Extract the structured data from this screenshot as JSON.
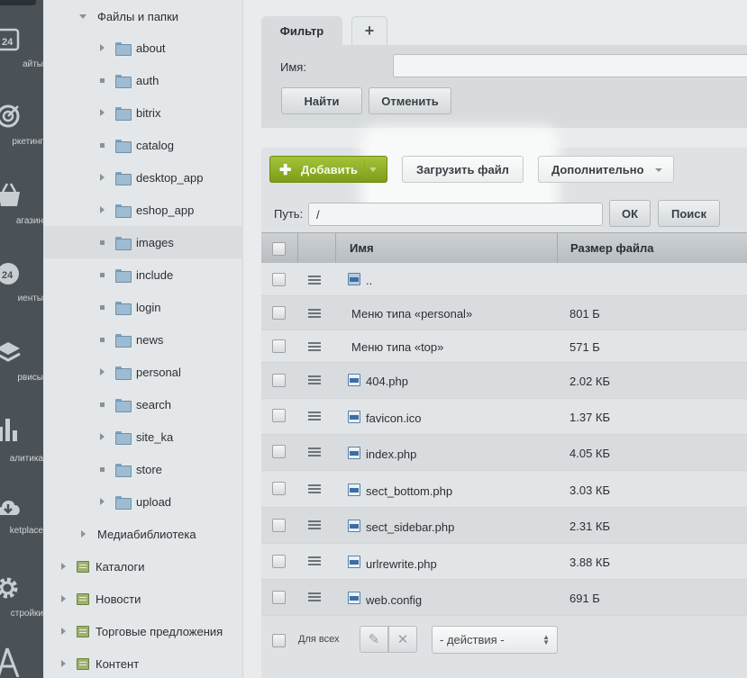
{
  "rail": {
    "items": [
      {
        "icon": "calendar-24-icon",
        "label": "айты"
      },
      {
        "icon": "target-icon",
        "label": "ркетинг"
      },
      {
        "icon": "basket-icon",
        "label": "агазин"
      },
      {
        "icon": "clients-24-icon",
        "label": "иенты"
      },
      {
        "icon": "layers-icon",
        "label": "рвисы"
      },
      {
        "icon": "bar-chart-icon",
        "label": "алитика"
      },
      {
        "icon": "cloud-download-icon",
        "label": "ketplace"
      },
      {
        "icon": "gear-icon",
        "label": "стройки"
      },
      {
        "icon": "logo-icon",
        "label": ""
      }
    ]
  },
  "tree": {
    "root": "Файлы и папки",
    "folders": [
      "about",
      "auth",
      "bitrix",
      "catalog",
      "desktop_app",
      "eshop_app",
      "images",
      "include",
      "login",
      "news",
      "personal",
      "search",
      "site_ka",
      "store",
      "upload"
    ],
    "media": "Медиабиблиотека",
    "sections": [
      "Каталоги",
      "Новости",
      "Торговые предложения",
      "Контент"
    ]
  },
  "filter": {
    "tab_label": "Фильтр",
    "add_tab": "+",
    "name_label": "Имя:",
    "name_value": "",
    "find_button": "Найти",
    "cancel_button": "Отменить"
  },
  "toolbar": {
    "add_button": "Добавить",
    "upload_button": "Загрузить файл",
    "more_button": "Дополнительно"
  },
  "path": {
    "label": "Путь:",
    "value": "/",
    "ok_button": "ОК",
    "search_button": "Поиск"
  },
  "table": {
    "columns": [
      "Имя",
      "Размер файла"
    ],
    "rows": [
      {
        "name": "..",
        "size": "",
        "icon": "folder-up-icon"
      },
      {
        "name": "Меню типа «personal»",
        "size": "801 Б",
        "icon": ""
      },
      {
        "name": "Меню типа «top»",
        "size": "571 Б",
        "icon": ""
      },
      {
        "name": "404.php",
        "size": "2.02 КБ",
        "icon": "php-file-icon"
      },
      {
        "name": "favicon.ico",
        "size": "1.37 КБ",
        "icon": "file-icon"
      },
      {
        "name": "index.php",
        "size": "4.05 КБ",
        "icon": "php-file-icon"
      },
      {
        "name": "sect_bottom.php",
        "size": "3.03 КБ",
        "icon": "php-file-icon"
      },
      {
        "name": "sect_sidebar.php",
        "size": "2.31 КБ",
        "icon": "php-file-icon"
      },
      {
        "name": "urlrewrite.php",
        "size": "3.88 КБ",
        "icon": "php-file-icon"
      },
      {
        "name": "web.config",
        "size": "691 Б",
        "icon": "file-icon"
      }
    ]
  },
  "footer": {
    "for_all_label": "Для всех",
    "actions_select": "- действия -"
  },
  "colors": {
    "rail": "#4b5257",
    "accent_green": "#8fae25",
    "panel": "#dfe2e5"
  }
}
